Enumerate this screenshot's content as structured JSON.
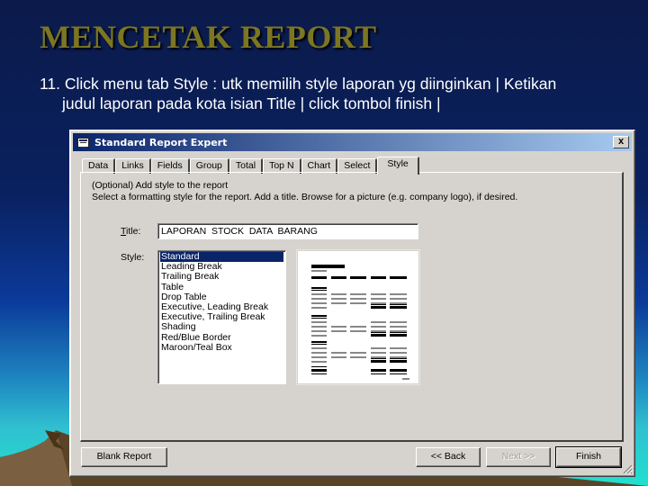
{
  "slide": {
    "title": "MENCETAK  REPORT",
    "instruction_line1": "11. Click menu tab Style : utk memilih style laporan yg diinginkan | Ketikan",
    "instruction_line2": "judul laporan pada kota isian Title |  click tombol finish |"
  },
  "dialog": {
    "title": "Standard Report Expert",
    "close_label": "x",
    "tabs": [
      {
        "label": "Data"
      },
      {
        "label": "Links"
      },
      {
        "label": "Fields"
      },
      {
        "label": "Group"
      },
      {
        "label": "Total"
      },
      {
        "label": "Top N"
      },
      {
        "label": "Chart"
      },
      {
        "label": "Select"
      },
      {
        "label": "Style",
        "active": true
      }
    ],
    "description_line1": "(Optional) Add style to the report",
    "description_line2": "Select a formatting style for the report.  Add a title.  Browse for a picture (e.g. company logo), if desired.",
    "title_label": "Title:",
    "title_value": "LAPORAN  STOCK  DATA  BARANG",
    "style_label": "Style:",
    "style_options": [
      "Standard",
      "Leading Break",
      "Trailing Break",
      "Table",
      "Drop Table",
      "Executive, Leading Break",
      "Executive, Trailing Break",
      "Shading",
      "Red/Blue Border",
      "Maroon/Teal Box"
    ],
    "selected_style": "Standard",
    "buttons": {
      "blank_report": "Blank Report",
      "back": "<< Back",
      "next": "Next >>",
      "finish": "Finish"
    }
  },
  "colors": {
    "title_gold": "#7c7622",
    "selection": "#0a246a",
    "dialog_face": "#d6d3ce"
  }
}
